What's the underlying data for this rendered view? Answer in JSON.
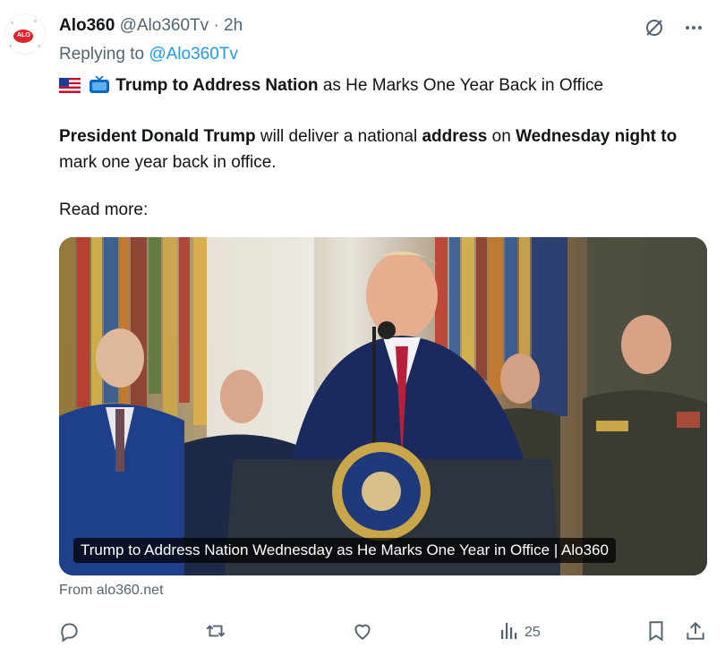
{
  "tweet": {
    "author_name": "Alo360",
    "author_handle": "@Alo360Tv",
    "separator": "·",
    "time": "2h",
    "reply_prefix": "Replying to",
    "reply_handle": "@Alo360Tv",
    "avatar_label": "ALO",
    "headline": {
      "bold": "Trump to Address Nation",
      "rest": "as He Marks One Year Back in Office"
    },
    "body": {
      "p1": "President Donald Trump",
      "p2": "will deliver a national",
      "p3": "address",
      "p4": "on",
      "p5": "Wednesday night to",
      "p6": "mark one year back in office."
    },
    "read_more": "Read more:",
    "card": {
      "caption": "Trump to Address Nation Wednesday as He Marks One Year in Office | Alo360",
      "source": "From alo360.net"
    },
    "views": "25"
  },
  "icons": [
    "grok-icon",
    "more-icon",
    "us-flag-icon",
    "tv-icon",
    "reply-icon",
    "retweet-icon",
    "like-icon",
    "views-icon",
    "bookmark-icon",
    "share-icon"
  ],
  "colors": {
    "link": "#1d9bf0",
    "muted": "#536471",
    "text": "#0f1419"
  }
}
